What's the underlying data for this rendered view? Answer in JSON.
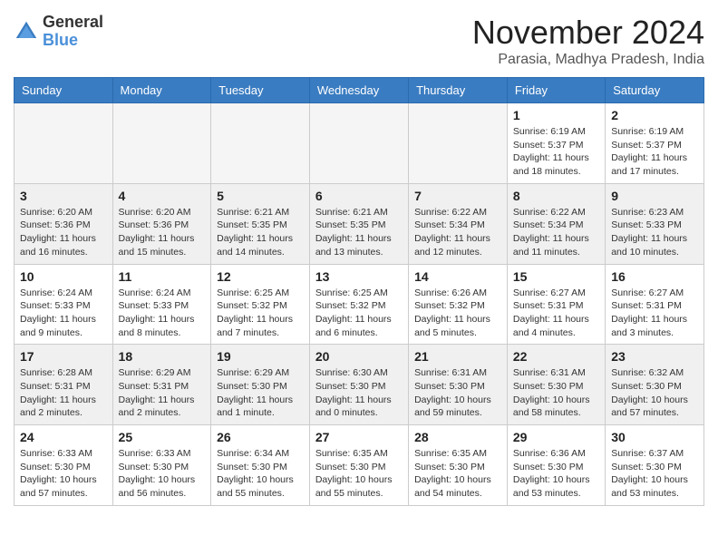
{
  "header": {
    "logo_line1": "General",
    "logo_line2": "Blue",
    "month_title": "November 2024",
    "location": "Parasia, Madhya Pradesh, India"
  },
  "weekdays": [
    "Sunday",
    "Monday",
    "Tuesday",
    "Wednesday",
    "Thursday",
    "Friday",
    "Saturday"
  ],
  "weeks": [
    [
      {
        "day": "",
        "empty": true
      },
      {
        "day": "",
        "empty": true
      },
      {
        "day": "",
        "empty": true
      },
      {
        "day": "",
        "empty": true
      },
      {
        "day": "",
        "empty": true
      },
      {
        "day": "1",
        "sunrise": "Sunrise: 6:19 AM",
        "sunset": "Sunset: 5:37 PM",
        "daylight": "Daylight: 11 hours and 18 minutes."
      },
      {
        "day": "2",
        "sunrise": "Sunrise: 6:19 AM",
        "sunset": "Sunset: 5:37 PM",
        "daylight": "Daylight: 11 hours and 17 minutes."
      }
    ],
    [
      {
        "day": "3",
        "sunrise": "Sunrise: 6:20 AM",
        "sunset": "Sunset: 5:36 PM",
        "daylight": "Daylight: 11 hours and 16 minutes."
      },
      {
        "day": "4",
        "sunrise": "Sunrise: 6:20 AM",
        "sunset": "Sunset: 5:36 PM",
        "daylight": "Daylight: 11 hours and 15 minutes."
      },
      {
        "day": "5",
        "sunrise": "Sunrise: 6:21 AM",
        "sunset": "Sunset: 5:35 PM",
        "daylight": "Daylight: 11 hours and 14 minutes."
      },
      {
        "day": "6",
        "sunrise": "Sunrise: 6:21 AM",
        "sunset": "Sunset: 5:35 PM",
        "daylight": "Daylight: 11 hours and 13 minutes."
      },
      {
        "day": "7",
        "sunrise": "Sunrise: 6:22 AM",
        "sunset": "Sunset: 5:34 PM",
        "daylight": "Daylight: 11 hours and 12 minutes."
      },
      {
        "day": "8",
        "sunrise": "Sunrise: 6:22 AM",
        "sunset": "Sunset: 5:34 PM",
        "daylight": "Daylight: 11 hours and 11 minutes."
      },
      {
        "day": "9",
        "sunrise": "Sunrise: 6:23 AM",
        "sunset": "Sunset: 5:33 PM",
        "daylight": "Daylight: 11 hours and 10 minutes."
      }
    ],
    [
      {
        "day": "10",
        "sunrise": "Sunrise: 6:24 AM",
        "sunset": "Sunset: 5:33 PM",
        "daylight": "Daylight: 11 hours and 9 minutes."
      },
      {
        "day": "11",
        "sunrise": "Sunrise: 6:24 AM",
        "sunset": "Sunset: 5:33 PM",
        "daylight": "Daylight: 11 hours and 8 minutes."
      },
      {
        "day": "12",
        "sunrise": "Sunrise: 6:25 AM",
        "sunset": "Sunset: 5:32 PM",
        "daylight": "Daylight: 11 hours and 7 minutes."
      },
      {
        "day": "13",
        "sunrise": "Sunrise: 6:25 AM",
        "sunset": "Sunset: 5:32 PM",
        "daylight": "Daylight: 11 hours and 6 minutes."
      },
      {
        "day": "14",
        "sunrise": "Sunrise: 6:26 AM",
        "sunset": "Sunset: 5:32 PM",
        "daylight": "Daylight: 11 hours and 5 minutes."
      },
      {
        "day": "15",
        "sunrise": "Sunrise: 6:27 AM",
        "sunset": "Sunset: 5:31 PM",
        "daylight": "Daylight: 11 hours and 4 minutes."
      },
      {
        "day": "16",
        "sunrise": "Sunrise: 6:27 AM",
        "sunset": "Sunset: 5:31 PM",
        "daylight": "Daylight: 11 hours and 3 minutes."
      }
    ],
    [
      {
        "day": "17",
        "sunrise": "Sunrise: 6:28 AM",
        "sunset": "Sunset: 5:31 PM",
        "daylight": "Daylight: 11 hours and 2 minutes."
      },
      {
        "day": "18",
        "sunrise": "Sunrise: 6:29 AM",
        "sunset": "Sunset: 5:31 PM",
        "daylight": "Daylight: 11 hours and 2 minutes."
      },
      {
        "day": "19",
        "sunrise": "Sunrise: 6:29 AM",
        "sunset": "Sunset: 5:30 PM",
        "daylight": "Daylight: 11 hours and 1 minute."
      },
      {
        "day": "20",
        "sunrise": "Sunrise: 6:30 AM",
        "sunset": "Sunset: 5:30 PM",
        "daylight": "Daylight: 11 hours and 0 minutes."
      },
      {
        "day": "21",
        "sunrise": "Sunrise: 6:31 AM",
        "sunset": "Sunset: 5:30 PM",
        "daylight": "Daylight: 10 hours and 59 minutes."
      },
      {
        "day": "22",
        "sunrise": "Sunrise: 6:31 AM",
        "sunset": "Sunset: 5:30 PM",
        "daylight": "Daylight: 10 hours and 58 minutes."
      },
      {
        "day": "23",
        "sunrise": "Sunrise: 6:32 AM",
        "sunset": "Sunset: 5:30 PM",
        "daylight": "Daylight: 10 hours and 57 minutes."
      }
    ],
    [
      {
        "day": "24",
        "sunrise": "Sunrise: 6:33 AM",
        "sunset": "Sunset: 5:30 PM",
        "daylight": "Daylight: 10 hours and 57 minutes."
      },
      {
        "day": "25",
        "sunrise": "Sunrise: 6:33 AM",
        "sunset": "Sunset: 5:30 PM",
        "daylight": "Daylight: 10 hours and 56 minutes."
      },
      {
        "day": "26",
        "sunrise": "Sunrise: 6:34 AM",
        "sunset": "Sunset: 5:30 PM",
        "daylight": "Daylight: 10 hours and 55 minutes."
      },
      {
        "day": "27",
        "sunrise": "Sunrise: 6:35 AM",
        "sunset": "Sunset: 5:30 PM",
        "daylight": "Daylight: 10 hours and 55 minutes."
      },
      {
        "day": "28",
        "sunrise": "Sunrise: 6:35 AM",
        "sunset": "Sunset: 5:30 PM",
        "daylight": "Daylight: 10 hours and 54 minutes."
      },
      {
        "day": "29",
        "sunrise": "Sunrise: 6:36 AM",
        "sunset": "Sunset: 5:30 PM",
        "daylight": "Daylight: 10 hours and 53 minutes."
      },
      {
        "day": "30",
        "sunrise": "Sunrise: 6:37 AM",
        "sunset": "Sunset: 5:30 PM",
        "daylight": "Daylight: 10 hours and 53 minutes."
      }
    ]
  ]
}
